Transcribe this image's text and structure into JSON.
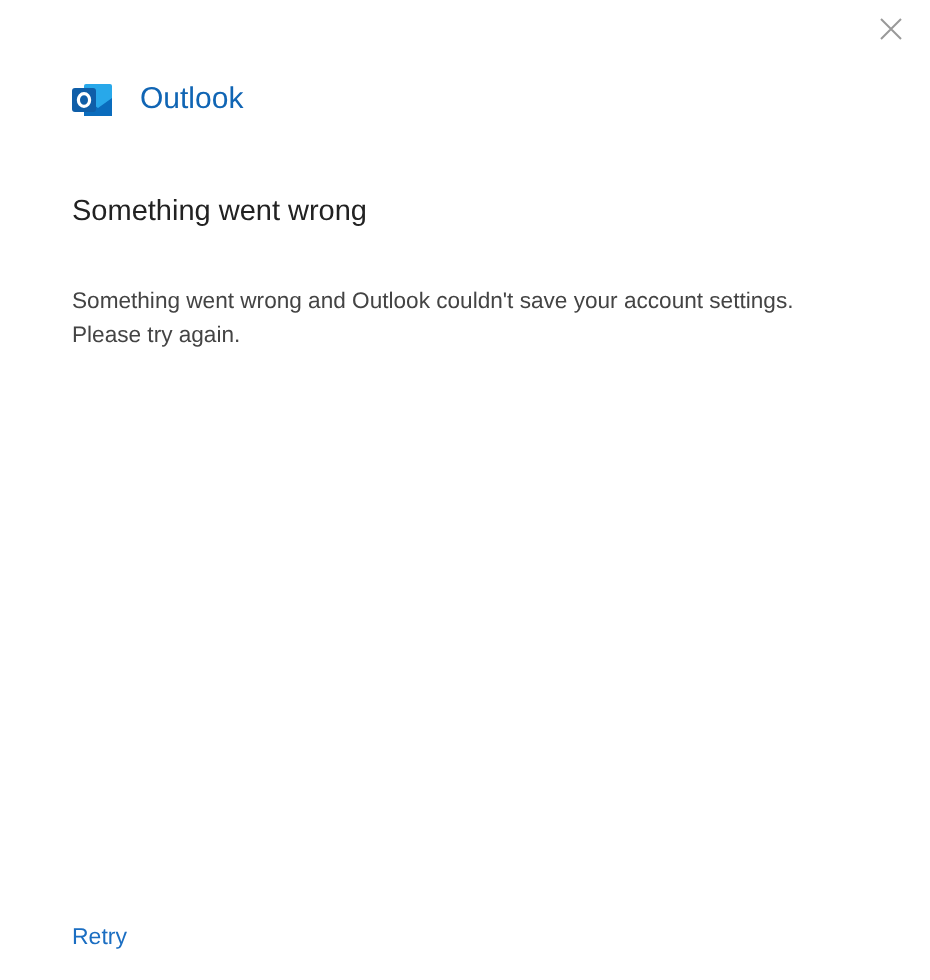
{
  "app": {
    "name": "Outlook"
  },
  "heading": "Something went wrong",
  "message": "Something went wrong and Outlook couldn't save your account settings. Please try again.",
  "actions": [
    {
      "label": "Retry"
    }
  ]
}
